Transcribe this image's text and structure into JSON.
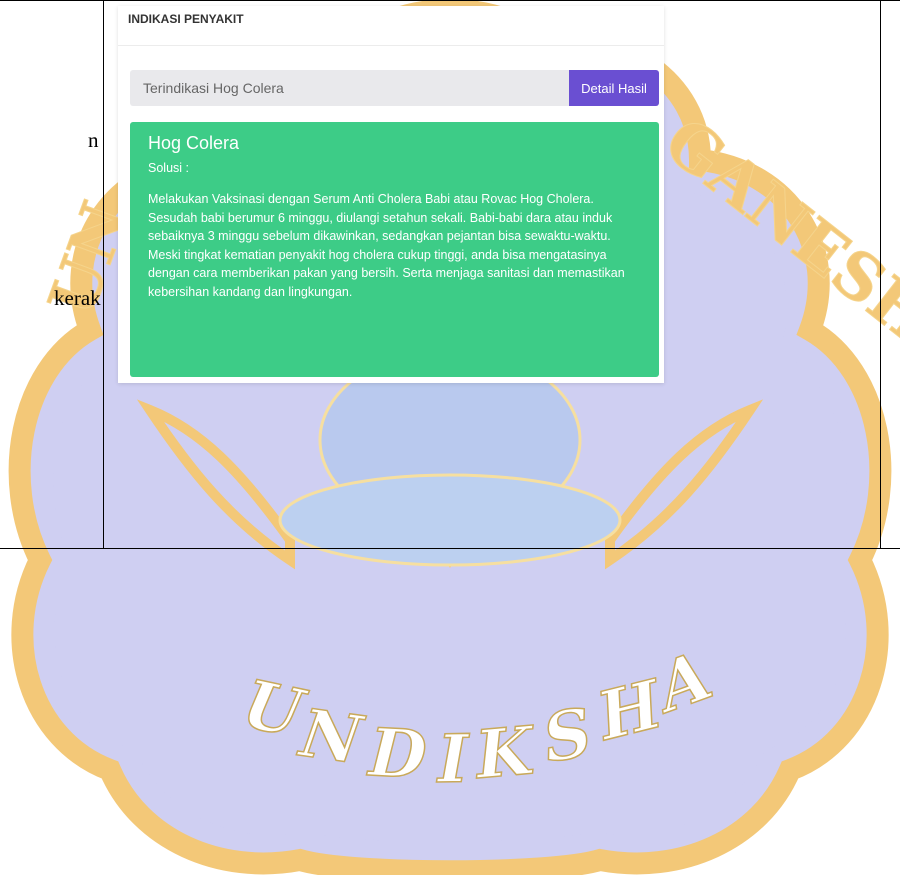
{
  "document": {
    "left_fragments": [
      "n",
      "kerak"
    ]
  },
  "watermark": {
    "arc_text_top": "UNIVERSITAS PENDIDIKAN GANESHA",
    "bottom_text": "UNDIKSHA",
    "colors": {
      "lavender": "#c9c9ef",
      "gold": "#f3c878"
    }
  },
  "card": {
    "header": "INDIKASI PENYAKIT",
    "result_value": "Terindikasi Hog Colera",
    "detail_button": "Detail Hasil",
    "alert": {
      "title": "Hog Colera",
      "label": "Solusi :",
      "body": "Melakukan Vaksinasi dengan Serum Anti Cholera Babi atau Rovac Hog Cholera. Sesudah babi berumur 6 minggu, diulangi setahun sekali. Babi-babi dara atau induk sebaiknya 3 minggu sebelum dikawinkan, sedangkan pejantan bisa sewaktu-waktu. Meski tingkat kematian penyakit hog cholera cukup tinggi, anda bisa mengatasinya dengan cara memberikan pakan yang bersih. Serta menjaga sanitasi dan memastikan kebersihan kandang dan lingkungan."
    },
    "colors": {
      "button": "#6a4fd2",
      "alert": "#3dcc87"
    }
  }
}
